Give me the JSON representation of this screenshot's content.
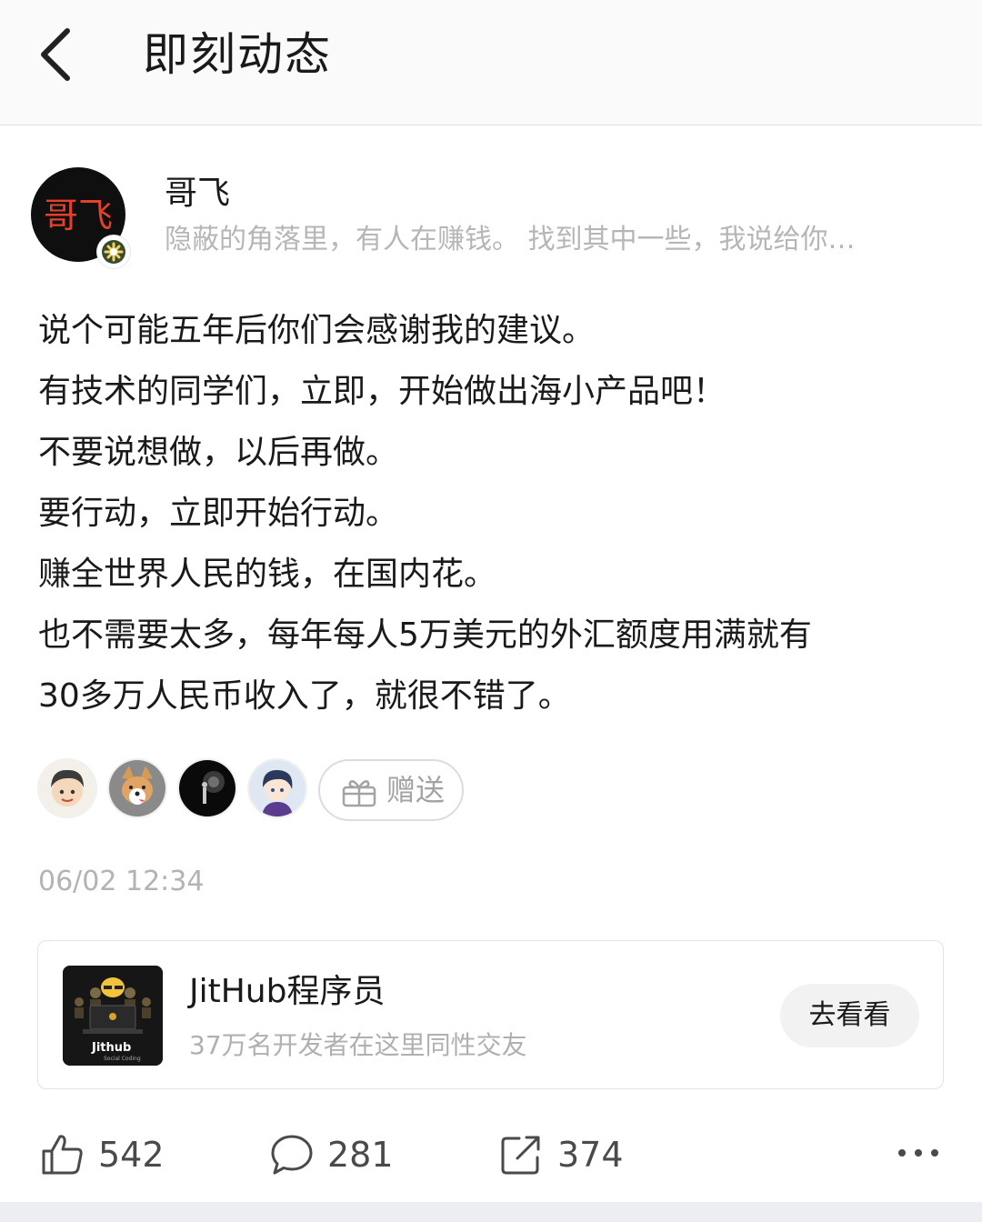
{
  "header": {
    "title": "即刻动态"
  },
  "author": {
    "name": "哥飞",
    "avatar_text": "哥飞",
    "bio": "隐蔽的角落里，有人在赚钱。  找到其中一些，我说给你…"
  },
  "post": {
    "lines": [
      "说个可能五年后你们会感谢我的建议。",
      "有技术的同学们，立即，开始做出海小产品吧！",
      "不要说想做，以后再做。",
      "要行动，立即开始行动。",
      "赚全世界人民的钱，在国内花。",
      "也不需要太多，每年每人5万美元的外汇额度用满就有",
      "30多万人民币收入了，就很不错了。"
    ],
    "timestamp": "06/02 12:34"
  },
  "gift": {
    "label": "赠送"
  },
  "card": {
    "name": "JitHub程序员",
    "subtitle": "37万名开发者在这里同性交友",
    "button": "去看看",
    "logo_text": "Jithub",
    "logo_subtext": "Social Coding"
  },
  "actions": {
    "likes": "542",
    "comments": "281",
    "shares": "374"
  },
  "colors": {
    "text": "#1a1a1a",
    "muted": "#b3b3b3",
    "avatar_text": "#e4402b",
    "card_button_bg": "#f2f2f2"
  }
}
